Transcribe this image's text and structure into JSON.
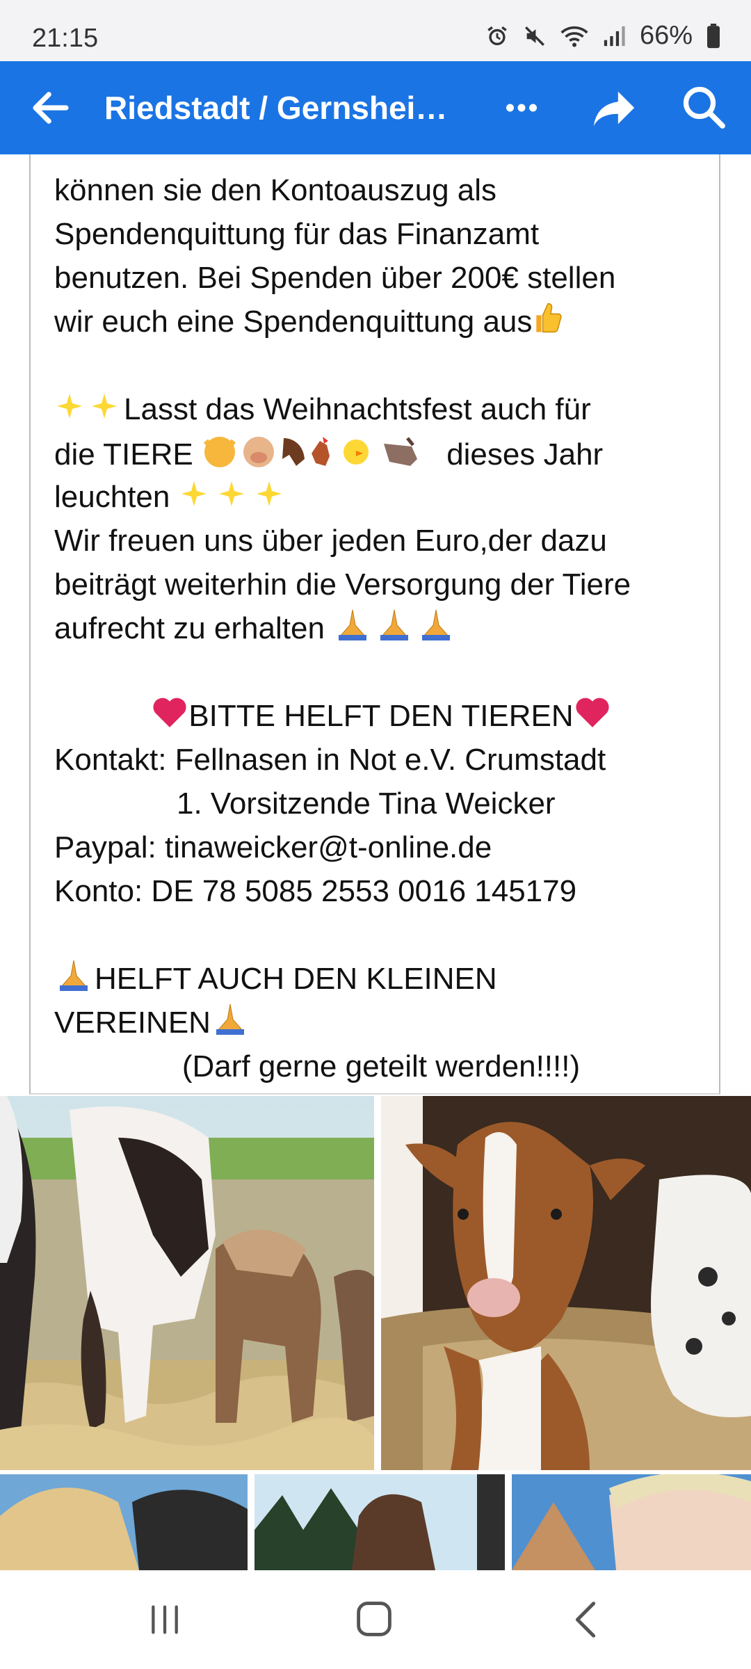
{
  "status_bar": {
    "time": "21:15",
    "battery": "66%"
  },
  "app_bar": {
    "title": "Riedstadt / Gernsheim ..."
  },
  "post": {
    "lines": [
      "können sie den Kontoauszug als",
      "Spendenquittung für das Finanzamt",
      "benutzen. Bei Spenden über 200€ stellen",
      "wir euch eine Spendenquittung aus",
      "Lasst das Weihnachtsfest auch für",
      "die TIERE",
      "dieses Jahr",
      "leuchten",
      "Wir freuen uns über jeden Euro,der dazu",
      "beiträgt weiterhin die Versorgung der Tiere",
      "aufrecht zu erhalten",
      "BITTE HELFT DEN TIEREN",
      "Kontakt: Fellnasen in Not e.V. Crumstadt",
      "1. Vorsitzende Tina Weicker",
      "Paypal: tinaweicker@t-online.de",
      "Konto: DE 78 5085 2553 0016 145179",
      "HELFT AUCH DEN KLEINEN",
      "VEREINEN",
      "(Darf gerne geteilt werden!!!!)"
    ]
  },
  "colors": {
    "facebook_blue": "#1b74e4",
    "heart_red": "#e0245e"
  }
}
